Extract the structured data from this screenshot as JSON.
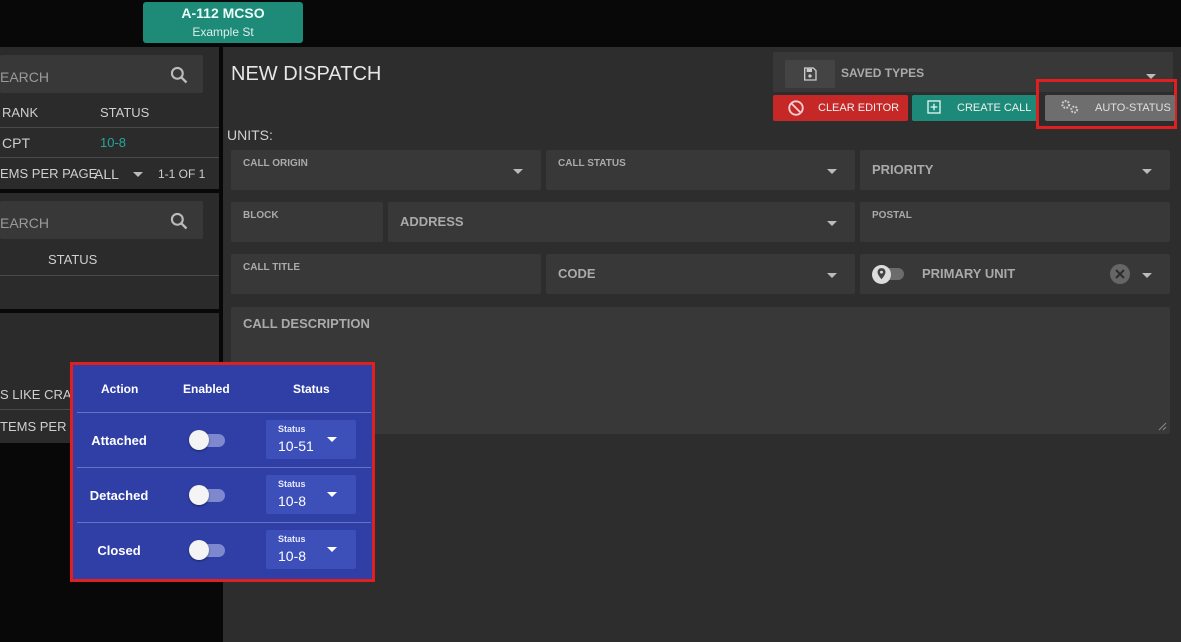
{
  "unit_badge": {
    "callsign": "A-112 MCSO",
    "street": "Example St"
  },
  "left_panel_1": {
    "search_label": "EARCH",
    "columns": [
      "RANK",
      "STATUS"
    ],
    "row": {
      "rank": "CPT",
      "status": "10-8"
    },
    "pagination": {
      "label": "EMS PER PAGE",
      "value": "ALL",
      "range": "1-1 OF 1"
    }
  },
  "left_panel_2": {
    "search_label": "EARCH",
    "columns": [
      "STATUS"
    ]
  },
  "left_panel_3": {
    "row_text": "S LIKE CRA...",
    "pagination_label": "TEMS PER P"
  },
  "dispatch": {
    "title": "NEW DISPATCH",
    "units_label": "UNITS:",
    "saved_types": "SAVED TYPES",
    "buttons": {
      "clear": "CLEAR EDITOR",
      "create": "CREATE CALL",
      "auto_status": "AUTO-STATUS"
    },
    "fields": {
      "call_origin": "CALL ORIGIN",
      "call_status": "CALL STATUS",
      "priority": "PRIORITY",
      "block": "BLOCK",
      "address": "ADDRESS",
      "postal": "POSTAL",
      "call_title": "CALL TITLE",
      "code": "CODE",
      "primary_unit": "PRIMARY UNIT",
      "call_description": "CALL DESCRIPTION"
    }
  },
  "auto_status_popup": {
    "headers": {
      "action": "Action",
      "enabled": "Enabled",
      "status": "Status"
    },
    "rows": [
      {
        "action": "Attached",
        "enabled": false,
        "status_label": "Status",
        "status_value": "10-51"
      },
      {
        "action": "Detached",
        "enabled": false,
        "status_label": "Status",
        "status_value": "10-8"
      },
      {
        "action": "Closed",
        "enabled": false,
        "status_label": "Status",
        "status_value": "10-8"
      }
    ]
  },
  "colors": {
    "accent_teal": "#1e8a78",
    "clear_red": "#c62828",
    "create_teal": "#1d8a79",
    "popup_blue": "#2f3fa5",
    "highlight_red": "#e02020",
    "status_teal": "#26a69a"
  }
}
